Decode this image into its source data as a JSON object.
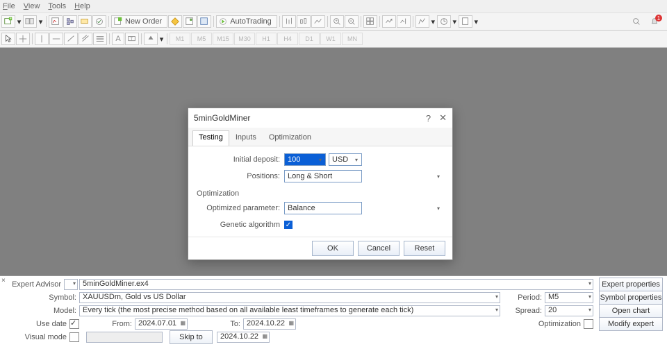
{
  "menu": {
    "file": "File",
    "view": "View",
    "tools": "Tools",
    "help": "Help"
  },
  "toolbar": {
    "new_order": "New Order",
    "autotrading": "AutoTrading"
  },
  "timeframes": [
    "M1",
    "M5",
    "M15",
    "M30",
    "H1",
    "H4",
    "D1",
    "W1",
    "MN"
  ],
  "dialog": {
    "title": "5minGoldMiner",
    "tabs": {
      "testing": "Testing",
      "inputs": "Inputs",
      "optimization": "Optimization"
    },
    "initial_deposit_lbl": "Initial deposit:",
    "initial_deposit_val": "100",
    "currency": "USD",
    "positions_lbl": "Positions:",
    "positions_val": "Long & Short",
    "opt_group": "Optimization",
    "opt_param_lbl": "Optimized parameter:",
    "opt_param_val": "Balance",
    "genetic_lbl": "Genetic algorithm",
    "btn_ok": "OK",
    "btn_cancel": "Cancel",
    "btn_reset": "Reset"
  },
  "tester": {
    "expert_advisor_lbl": "Expert Advisor",
    "expert_advisor_val": "5minGoldMiner.ex4",
    "symbol_lbl": "Symbol:",
    "symbol_val": "XAUUSDm, Gold vs US Dollar",
    "model_lbl": "Model:",
    "model_val": "Every tick (the most precise method based on all available least timeframes to generate each tick)",
    "use_date_lbl": "Use date",
    "from_lbl": "From:",
    "from_val": "2024.07.01",
    "to_lbl": "To:",
    "to_val": "2024.10.22",
    "visual_mode_lbl": "Visual mode",
    "skip_to_lbl": "Skip to",
    "skip_to_val": "2024.10.22",
    "period_lbl": "Period:",
    "period_val": "M5",
    "spread_lbl": "Spread:",
    "spread_val": "20",
    "optimization_lbl": "Optimization",
    "btn_expert_props": "Expert properties",
    "btn_symbol_props": "Symbol properties",
    "btn_open_chart": "Open chart",
    "btn_modify": "Modify expert"
  }
}
